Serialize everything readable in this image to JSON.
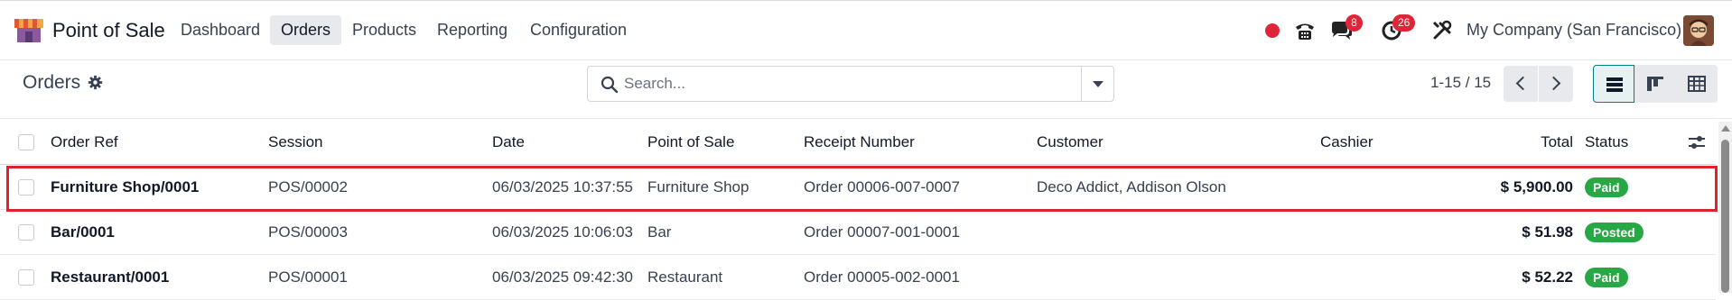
{
  "app": {
    "name": "Point of Sale",
    "menu": [
      {
        "label": "Dashboard",
        "active": false
      },
      {
        "label": "Orders",
        "active": true
      },
      {
        "label": "Products",
        "active": false
      },
      {
        "label": "Reporting",
        "active": false
      },
      {
        "label": "Configuration",
        "active": false
      }
    ],
    "systray": {
      "messages_count": "8",
      "activities_count": "26",
      "company": "My Company (San Francisco)",
      "icons": [
        "recording-dot-icon",
        "phone-icon",
        "chat-icon",
        "clock-icon",
        "tools-icon"
      ]
    }
  },
  "control_panel": {
    "title": "Orders",
    "search": {
      "placeholder": "Search...",
      "value": ""
    },
    "pager": {
      "value": "1-15 / 15"
    },
    "views": [
      "list",
      "kanban",
      "pivot"
    ],
    "active_view": "list"
  },
  "table": {
    "headers": {
      "order_ref": "Order Ref",
      "session": "Session",
      "date": "Date",
      "point_of_sale": "Point of Sale",
      "receipt_number": "Receipt Number",
      "customer": "Customer",
      "cashier": "Cashier",
      "total": "Total",
      "status": "Status"
    },
    "rows": [
      {
        "order_ref": "Furniture Shop/0001",
        "session": "POS/00002",
        "date": "06/03/2025 10:37:55",
        "point_of_sale": "Furniture Shop",
        "receipt_number": "Order 00006-007-0007",
        "customer": "Deco Addict, Addison Olson",
        "cashier": "",
        "total": "$ 5,900.00",
        "status": "Paid",
        "highlighted": true
      },
      {
        "order_ref": "Bar/0001",
        "session": "POS/00003",
        "date": "06/03/2025 10:06:03",
        "point_of_sale": "Bar",
        "receipt_number": "Order 00007-001-0001",
        "customer": "",
        "cashier": "",
        "total": "$ 51.98",
        "status": "Posted",
        "highlighted": false
      },
      {
        "order_ref": "Restaurant/0001",
        "session": "POS/00001",
        "date": "06/03/2025 09:42:30",
        "point_of_sale": "Restaurant",
        "receipt_number": "Order 00005-002-0001",
        "customer": "",
        "cashier": "",
        "total": "$ 52.22",
        "status": "Paid",
        "highlighted": false
      }
    ]
  },
  "colors": {
    "accent": "#017e84",
    "status_green": "#28a745",
    "badge_red": "#e0243a",
    "highlight_red": "#e0202b"
  }
}
